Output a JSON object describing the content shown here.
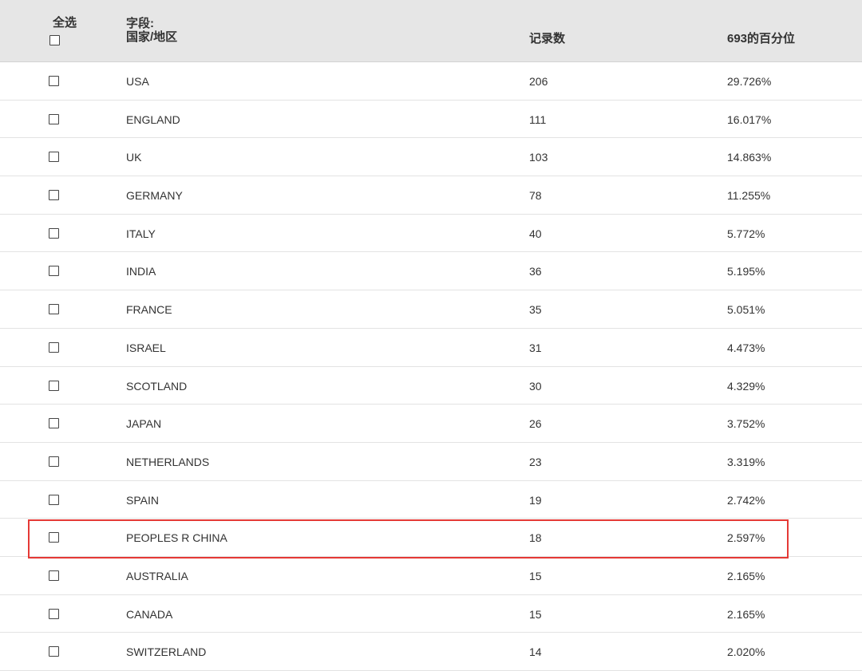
{
  "header": {
    "select_all": "全选",
    "field_prefix": "字段:",
    "field_name": "国家/地区",
    "count": "记录数",
    "percent": "693的百分位"
  },
  "rows": [
    {
      "name": "USA",
      "count": "206",
      "percent": "29.726%"
    },
    {
      "name": "ENGLAND",
      "count": "111",
      "percent": "16.017%"
    },
    {
      "name": "UK",
      "count": "103",
      "percent": "14.863%"
    },
    {
      "name": "GERMANY",
      "count": "78",
      "percent": "11.255%"
    },
    {
      "name": "ITALY",
      "count": "40",
      "percent": "5.772%"
    },
    {
      "name": "INDIA",
      "count": "36",
      "percent": "5.195%"
    },
    {
      "name": "FRANCE",
      "count": "35",
      "percent": "5.051%"
    },
    {
      "name": "ISRAEL",
      "count": "31",
      "percent": "4.473%"
    },
    {
      "name": "SCOTLAND",
      "count": "30",
      "percent": "4.329%"
    },
    {
      "name": "JAPAN",
      "count": "26",
      "percent": "3.752%"
    },
    {
      "name": "NETHERLANDS",
      "count": "23",
      "percent": "3.319%"
    },
    {
      "name": "SPAIN",
      "count": "19",
      "percent": "2.742%"
    },
    {
      "name": "PEOPLES R CHINA",
      "count": "18",
      "percent": "2.597%"
    },
    {
      "name": "AUSTRALIA",
      "count": "15",
      "percent": "2.165%"
    },
    {
      "name": "CANADA",
      "count": "15",
      "percent": "2.165%"
    },
    {
      "name": "SWITZERLAND",
      "count": "14",
      "percent": "2.020%"
    }
  ],
  "highlight": {
    "row": "PEOPLES R CHINA",
    "color": "#e53935"
  }
}
